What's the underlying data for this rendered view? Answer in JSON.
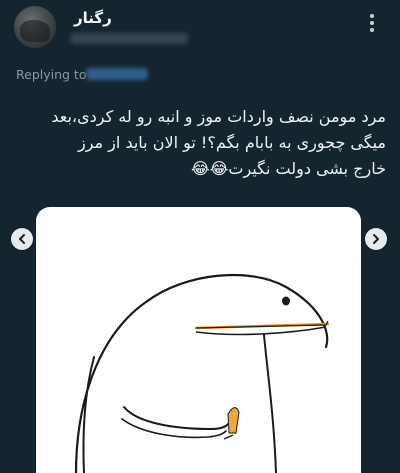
{
  "tweet": {
    "display_name": "رگنار",
    "replying_label": "Replying to",
    "text_lines": [
      "مرد مومن نصف واردات موز و انبه رو له کردی،بعد",
      "میگی چجوری به بابام بگم؟! تو الان باید از مرز",
      "خارج بشی دولت نگیرت😂😂"
    ]
  },
  "media": {
    "description_icon": "flork-meme-character"
  },
  "icons": {
    "more": "more-vertical-icon",
    "prev": "chevron-left-icon",
    "next": "chevron-right-icon"
  },
  "colors": {
    "background": "#152530",
    "mention_blue": "#2f5f8c",
    "beak_orange": "#f08a1e"
  }
}
